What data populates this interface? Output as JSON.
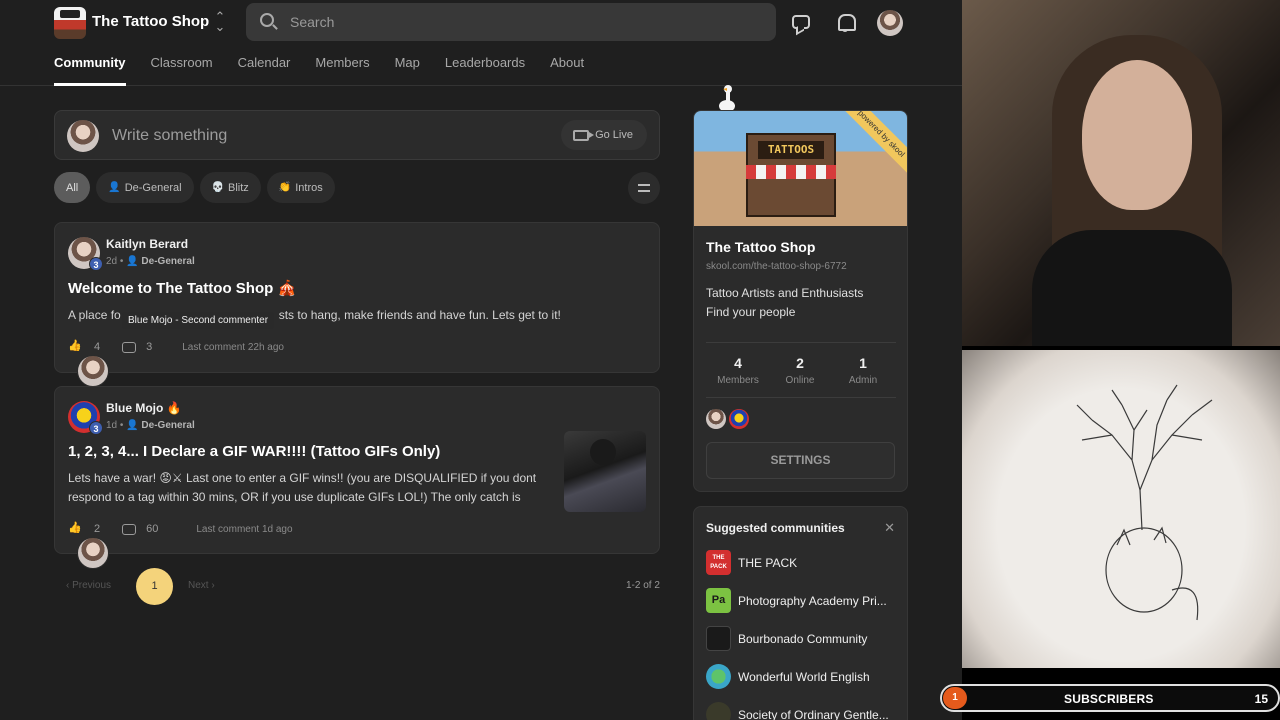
{
  "header": {
    "shop_name": "The Tattoo Shop",
    "search_placeholder": "Search"
  },
  "tabs": [
    "Community",
    "Classroom",
    "Calendar",
    "Members",
    "Map",
    "Leaderboards",
    "About"
  ],
  "composer": {
    "placeholder": "Write something",
    "go_live_label": "Go Live"
  },
  "filters": [
    {
      "label": "All",
      "active": true,
      "emoji": ""
    },
    {
      "label": "De-General",
      "active": false,
      "emoji": "👤"
    },
    {
      "label": "Blitz",
      "active": false,
      "emoji": "💀"
    },
    {
      "label": "Intros",
      "active": false,
      "emoji": "👏"
    }
  ],
  "posts": [
    {
      "author": "Kaitlyn Berard",
      "level": "3",
      "time": "2d",
      "category": "De-General",
      "title": "Welcome to The Tattoo Shop 🎪",
      "body_start": "A place fo",
      "body_end": "sts to hang, make friends and have fun. Lets get to it!",
      "likes": "4",
      "comments": "3",
      "last_comment": "Last comment 22h ago"
    },
    {
      "author": "Blue Mojo 🔥",
      "level": "3",
      "time": "1d",
      "category": "De-General",
      "title": "1, 2, 3, 4... I Declare a GIF WAR!!!! (Tattoo GIFs Only)",
      "body": "Lets have a war! 😡⚔ Last one to enter a GIF wins!! (you are DISQUALIFIED if you dont respond to a tag within 30 mins, OR if you use duplicate GIFs LOL!) The only catch is",
      "likes": "2",
      "comments": "60",
      "last_comment": "Last comment 1d ago"
    }
  ],
  "tooltip": "Blue Mojo - Second commenter",
  "pagination": {
    "previous": "Previous",
    "next": "Next",
    "current": "1",
    "range": "1-2 of 2"
  },
  "about_card": {
    "banner_sign": "TATTOOS",
    "ribbon": "powered by skool",
    "name": "The Tattoo Shop",
    "url": "skool.com/the-tattoo-shop-6772",
    "desc_line1": "Tattoo Artists and Enthusiasts",
    "desc_line2": "Find your people",
    "stats": [
      {
        "value": "4",
        "label": "Members"
      },
      {
        "value": "2",
        "label": "Online"
      },
      {
        "value": "1",
        "label": "Admin"
      }
    ],
    "settings_label": "SETTINGS"
  },
  "suggested": {
    "title": "Suggested communities",
    "items": [
      {
        "name": "THE PACK",
        "logo_text": "THE PACK",
        "color": "#d32f2f"
      },
      {
        "name": "Photography Academy Pri...",
        "logo_text": "Pa",
        "color": "#7cc242"
      },
      {
        "name": "Bourbonado Community",
        "logo_text": "",
        "color": "#1a1a1a"
      },
      {
        "name": "Wonderful World English",
        "logo_text": "",
        "color": "#3aa6c8"
      },
      {
        "name": "Society of Ordinary Gentle...",
        "logo_text": "",
        "color": "#3a3a2a"
      }
    ]
  },
  "stream": {
    "subscribers_label": "SUBSCRIBERS",
    "subscribers_count": "1",
    "subscribers_goal": "15"
  },
  "colors": {
    "accent_page": "#f4d37b",
    "level_badge": "#3e5fb0",
    "sub_badge": "#e55a1c"
  }
}
